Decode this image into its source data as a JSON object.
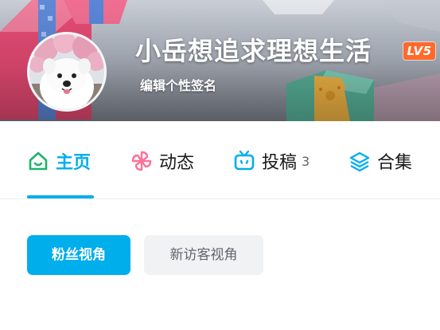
{
  "profile": {
    "username": "小岳想追求理想生活",
    "level": "LV5",
    "signature": "编辑个性签名"
  },
  "tabs": [
    {
      "label": "主页",
      "icon": "home-icon",
      "active": true
    },
    {
      "label": "动态",
      "icon": "pinwheel-icon",
      "active": false
    },
    {
      "label": "投稿",
      "icon": "tv-icon",
      "count": "3",
      "active": false
    },
    {
      "label": "合集",
      "icon": "layers-icon",
      "active": false
    }
  ],
  "view_switch": {
    "fans_view": "粉丝视角",
    "new_visitor_view": "新访客视角"
  },
  "colors": {
    "accent": "#00aeec",
    "level_badge": "#ff6a2a",
    "pinwheel": "#fb7299",
    "text_primary": "#18191c",
    "text_secondary": "#61666d"
  }
}
